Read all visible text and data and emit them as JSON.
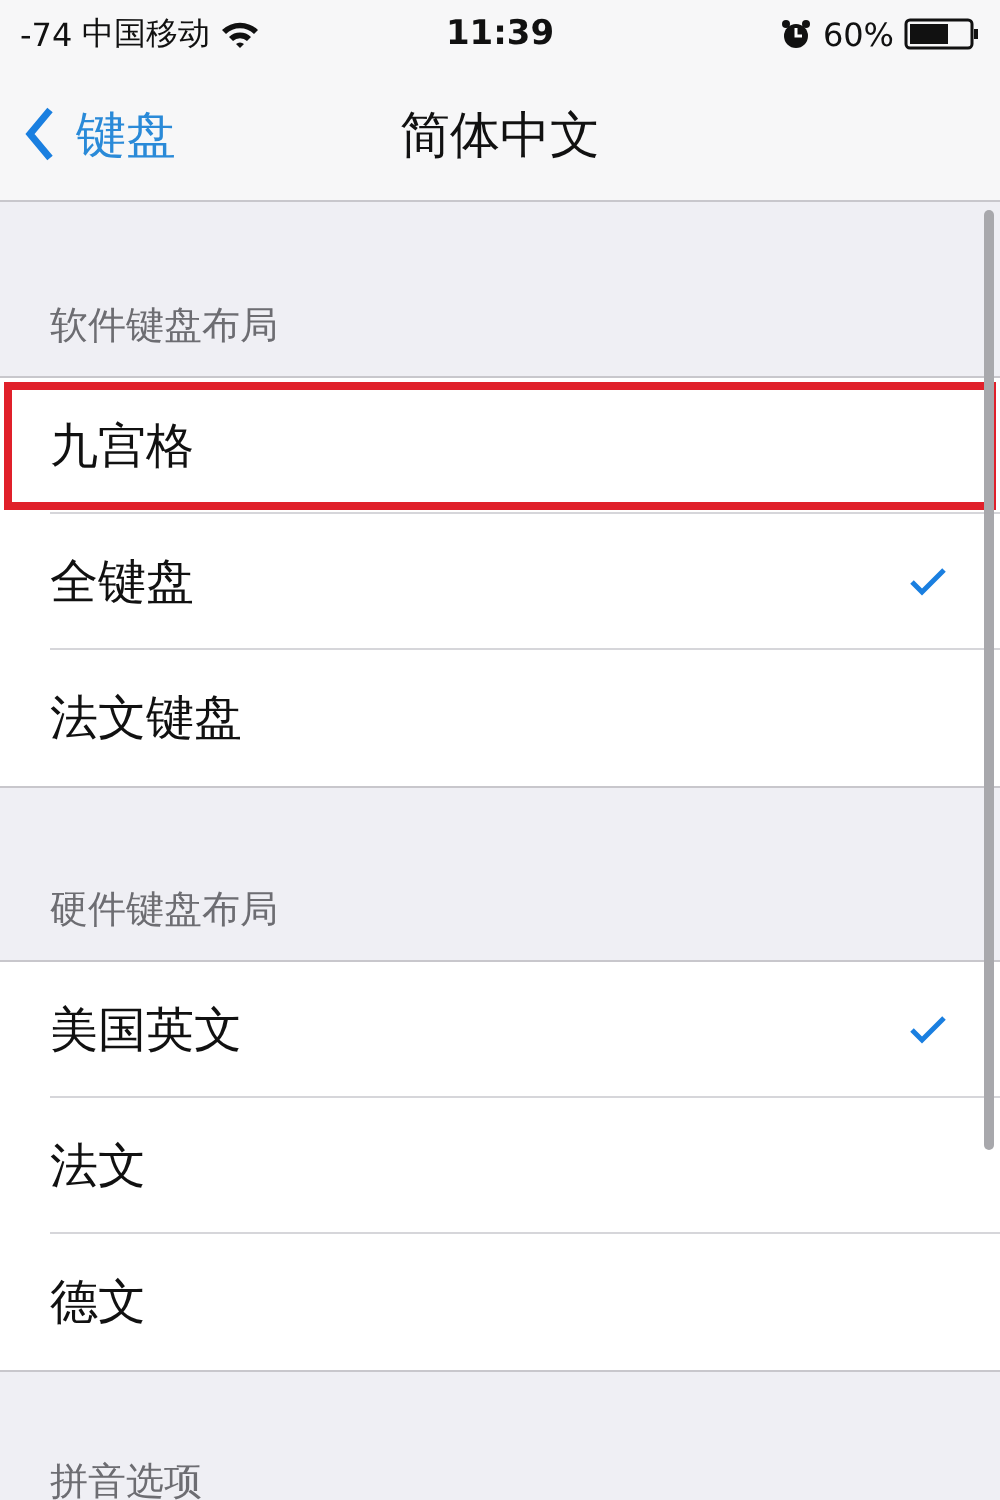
{
  "status_bar": {
    "signal": "-74",
    "carrier": "中国移动",
    "time": "11:39",
    "battery": "60%"
  },
  "nav": {
    "back": "键盘",
    "title": "简体中文"
  },
  "sections": [
    {
      "header": "软件键盘布局",
      "items": [
        {
          "label": "九宫格",
          "checked": false,
          "highlighted": true
        },
        {
          "label": "全键盘",
          "checked": true,
          "highlighted": false
        },
        {
          "label": "法文键盘",
          "checked": false,
          "highlighted": false
        }
      ]
    },
    {
      "header": "硬件键盘布局",
      "items": [
        {
          "label": "美国英文",
          "checked": true,
          "highlighted": false
        },
        {
          "label": "法文",
          "checked": false,
          "highlighted": false
        },
        {
          "label": "德文",
          "checked": false,
          "highlighted": false
        }
      ]
    },
    {
      "header": "拼音选项"
    }
  ]
}
